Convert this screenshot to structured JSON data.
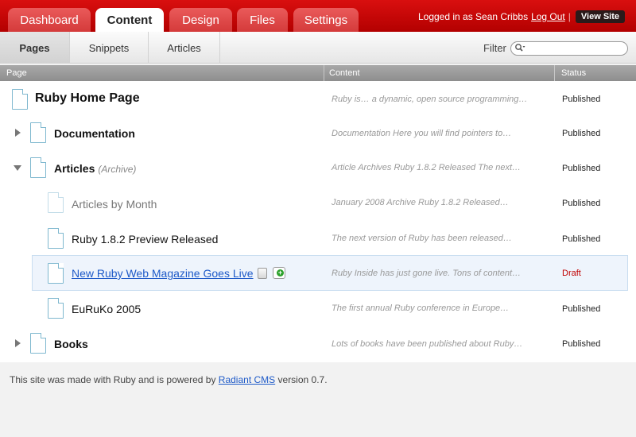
{
  "tabs": [
    {
      "label": "Dashboard",
      "active": false
    },
    {
      "label": "Content",
      "active": true
    },
    {
      "label": "Design",
      "active": false
    },
    {
      "label": "Files",
      "active": false
    },
    {
      "label": "Settings",
      "active": false
    }
  ],
  "userbar": {
    "logged_in_text": "Logged in as Sean Cribbs",
    "logout_label": "Log Out",
    "separator": "|",
    "view_site_label": "View Site"
  },
  "subnav": {
    "items": [
      {
        "label": "Pages",
        "active": true
      },
      {
        "label": "Snippets",
        "active": false
      },
      {
        "label": "Articles",
        "active": false
      }
    ],
    "filter_label": "Filter",
    "filter_value": ""
  },
  "table": {
    "columns": [
      "Page",
      "Content",
      "Status"
    ],
    "rows": [
      {
        "title": "Ruby Home Page",
        "subtitle": "",
        "content": "Ruby is… a dynamic, open source programming…",
        "status": "Published"
      },
      {
        "title": "Documentation",
        "subtitle": "",
        "content": "Documentation  Here you will find pointers to…",
        "status": "Published"
      },
      {
        "title": "Articles",
        "subtitle": "(Archive)",
        "content": "Article Archives  Ruby 1.8.2 Released  The next…",
        "status": "Published"
      },
      {
        "title": "Articles by Month",
        "subtitle": "",
        "content": "January 2008 Archive  Ruby 1.8.2 Released…",
        "status": "Published"
      },
      {
        "title": "Ruby 1.8.2 Preview Released",
        "subtitle": "",
        "content": "The next version of Ruby has been released…",
        "status": "Published"
      },
      {
        "title": "New Ruby Web Magazine Goes Live",
        "subtitle": "",
        "content": "Ruby Inside has just gone live. Tons of content…",
        "status": "Draft"
      },
      {
        "title": "EuRuKo 2005",
        "subtitle": "",
        "content": "The first annual Ruby conference in Europe…",
        "status": "Published"
      },
      {
        "title": "Books",
        "subtitle": "",
        "content": "Lots of books have been published about Ruby…",
        "status": "Published"
      }
    ]
  },
  "footer": {
    "prefix": "This site was made with Ruby and is powered by",
    "link_label": "Radiant CMS",
    "suffix": "version 0.7."
  },
  "colors": {
    "header_red": "#c00000",
    "link_blue": "#1e5ac8",
    "draft_red": "#c00000"
  }
}
